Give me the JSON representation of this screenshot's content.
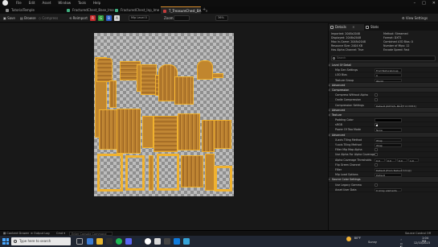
{
  "menu": [
    "File",
    "Edit",
    "Asset",
    "Window",
    "Tools",
    "Help"
  ],
  "tabs": [
    {
      "label": "TutorialTemple",
      "color": "#8a8a8a",
      "active": false
    },
    {
      "label": "FracturedChest_Base_Ime",
      "color": "#3fae7f",
      "active": false
    },
    {
      "label": "FracturedChest_Inp_Ime",
      "color": "#3fae7f",
      "active": false
    },
    {
      "label": "T_TreasureChest_BA",
      "color": "#c53b3b",
      "active": true
    }
  ],
  "toolbar": {
    "save": "Save",
    "browse": "Browse",
    "compress": "Compress",
    "reimport": "Reimport",
    "channels": [
      "R",
      "G",
      "B",
      "A"
    ],
    "channel_colors": [
      "#c62b2b",
      "#2f9a3a",
      "#2b5ec6",
      "#d8d8d8"
    ],
    "mip_label": "Mip Level 0",
    "zoom_label": "Zoom",
    "zoom_value": "36%",
    "view_settings": "View Settings"
  },
  "details": {
    "tab_details": "Details",
    "tab_stats": "Stats",
    "info": [
      "Imported: 2048x2048",
      "Method: Streamed",
      "Displayed: 2048x2048",
      "Format: DXT1",
      "Max In-Game: 2048x2048",
      "Combined LOD Bias: 0",
      "Resource Size: 2404 KB",
      "Number of Mips: 12",
      "Has Alpha Channel: True",
      "Encode Speed: Fast"
    ],
    "search_placeholder": "Search",
    "rows": [
      {
        "label": "Level Of Detail",
        "kind": "section"
      },
      {
        "label": "Mip Gen Settings",
        "kind": "select",
        "value": "FromTextureGroup"
      },
      {
        "label": "LOD Bias",
        "kind": "value",
        "value": "0"
      },
      {
        "label": "Texture Group",
        "kind": "select",
        "value": "World"
      },
      {
        "label": "Advanced",
        "kind": "section"
      },
      {
        "label": "Compression",
        "kind": "section"
      },
      {
        "label": "Compress Without Alpha",
        "kind": "check",
        "on": false
      },
      {
        "label": "Oodle Compression",
        "kind": "check",
        "on": false
      },
      {
        "label": "Compression Settings",
        "kind": "select",
        "value": "Default (DXT1/5, BC1/3 on DX11)"
      },
      {
        "label": "Advanced",
        "kind": "section"
      },
      {
        "label": "Texture",
        "kind": "section"
      },
      {
        "label": "Padding Color",
        "kind": "swatch"
      },
      {
        "label": "sRGB",
        "kind": "check",
        "on": true
      },
      {
        "label": "Power Of Two Mode",
        "kind": "select",
        "value": "None"
      },
      {
        "label": "Advanced",
        "kind": "section"
      },
      {
        "label": "X-axis Tiling Method",
        "kind": "select",
        "value": "Wrap"
      },
      {
        "label": "Y-axis Tiling Method",
        "kind": "select",
        "value": "Wrap"
      },
      {
        "label": "Filter Mip Map Alpha",
        "kind": "check",
        "on": false
      },
      {
        "label": "Use Alpha For Alpha Coverage",
        "kind": "check",
        "on": false
      },
      {
        "label": "Alpha Coverage Thresholds",
        "kind": "vector",
        "values": [
          "0.0",
          "0.0",
          "0.0",
          "1.0"
        ]
      },
      {
        "label": "Flip Green Channel",
        "kind": "check",
        "on": false
      },
      {
        "label": "Filter",
        "kind": "select",
        "value": "Default (From Texture Group)"
      },
      {
        "label": "Mip Load Options",
        "kind": "select",
        "value": "Default"
      },
      {
        "label": "Source Color Settings",
        "kind": "section"
      },
      {
        "label": "Use Legacy Gamma",
        "kind": "check",
        "on": false
      },
      {
        "label": "Asset User Data",
        "kind": "select",
        "value": "0 Array elements"
      }
    ]
  },
  "statusbar": {
    "content_drawer": "Content Drawer",
    "output_log": "Output Log",
    "cmd": "Cmd",
    "console_placeholder": "Enter Console Command",
    "source_control": "Source Control Off"
  },
  "taskbar": {
    "search_placeholder": "Type here to search",
    "weather": "80°F",
    "weather_desc": "Sunny",
    "time": "1:04 PM",
    "date": "12/10/2023"
  }
}
